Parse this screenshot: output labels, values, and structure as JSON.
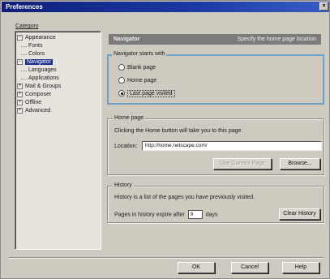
{
  "window": {
    "title": "Preferences",
    "close_glyph": "×"
  },
  "category": {
    "label": "Category",
    "items": [
      {
        "label": "Appearance",
        "expander": "−",
        "level": 0
      },
      {
        "label": "Fonts",
        "level": 1
      },
      {
        "label": "Colors",
        "level": 1
      },
      {
        "label": "Navigator",
        "expander": "−",
        "level": 0,
        "selected": true
      },
      {
        "label": "Languages",
        "level": 1
      },
      {
        "label": "Applications",
        "level": 1
      },
      {
        "label": "Mail & Groups",
        "expander": "+",
        "level": 0
      },
      {
        "label": "Composer",
        "expander": "+",
        "level": 0
      },
      {
        "label": "Offline",
        "expander": "+",
        "level": 0
      },
      {
        "label": "Advanced",
        "expander": "+",
        "level": 0
      }
    ]
  },
  "panel": {
    "title": "Navigator",
    "description": "Specify the home page location"
  },
  "navigator_starts": {
    "title": "Navigator starts with",
    "options": [
      "Blank page",
      "Home page",
      "Last page visited"
    ],
    "selected_index": 2
  },
  "home_page": {
    "title": "Home page",
    "description": "Clicking the Home button will take you to this page.",
    "location_label": "Location:",
    "location_value": "http://home.netscape.com/",
    "use_current_label": "Use Current Page",
    "browse_label": "Browse..."
  },
  "history": {
    "title": "History",
    "description": "History is a list of the pages you have previously visited.",
    "expire_label": "Pages in history expire after",
    "expire_value": "9",
    "days_label": "days",
    "clear_label": "Clear History"
  },
  "buttons": {
    "ok": "OK",
    "cancel": "Cancel",
    "help": "Help"
  },
  "colors": {
    "titlebar": "#0e1f7a",
    "selection": "#1c2f8a",
    "focus_frame": "#6fa0c9"
  }
}
